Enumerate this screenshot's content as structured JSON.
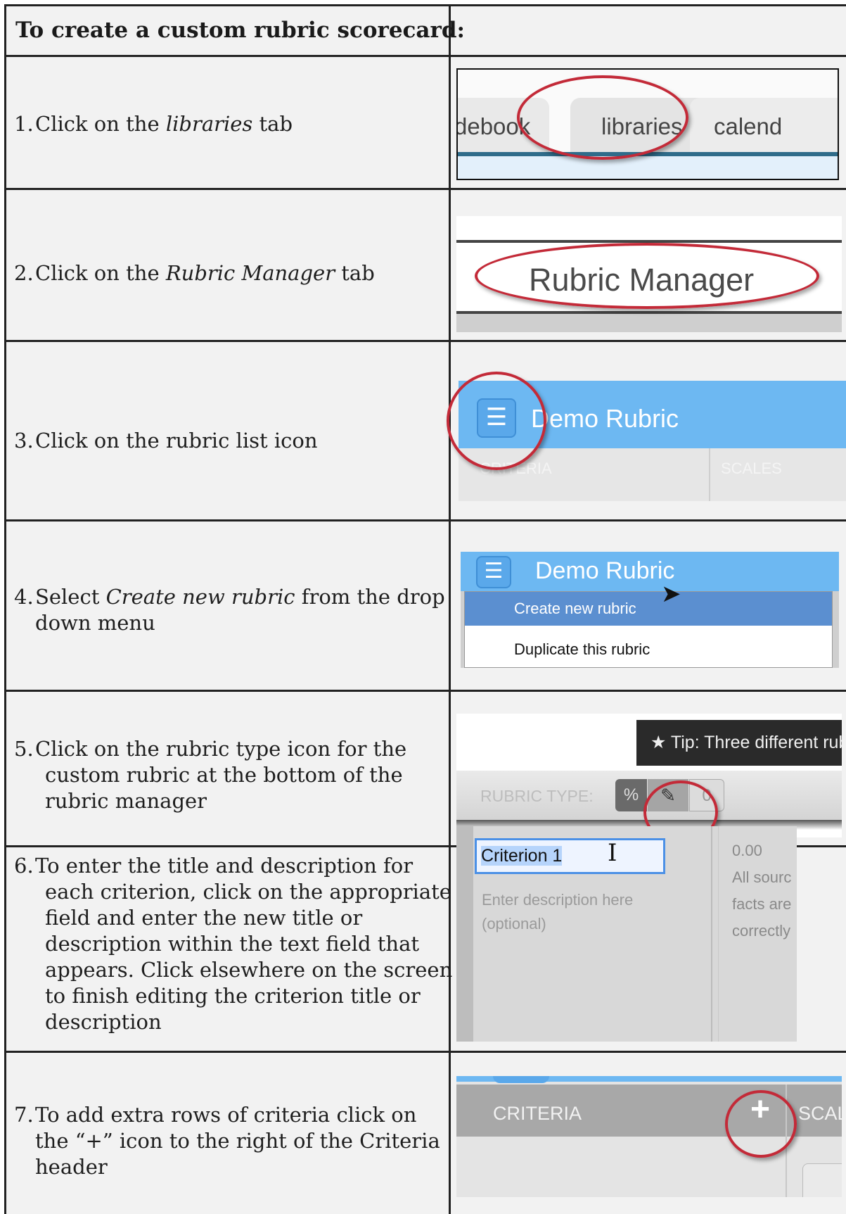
{
  "header": {
    "title": "To create a custom rubric scorecard:"
  },
  "steps": [
    {
      "num": "1.",
      "pre": "Click on the ",
      "em": "libraries",
      "post": " tab"
    },
    {
      "num": "2.",
      "pre": "Click on the ",
      "em": "Rubric Manager",
      "post": " tab"
    },
    {
      "num": "3.",
      "line1": "Click on the rubric list icon"
    },
    {
      "num": "4.",
      "pre": "Select ",
      "em": "Create new rubric",
      "post": " from the drop",
      "line2": "down menu"
    },
    {
      "num": "5.",
      "line1": "Click on the rubric type icon for the",
      "line2": "custom rubric at the bottom of the",
      "line3": "rubric manager"
    },
    {
      "num": "6.",
      "line1": "To enter the title and description for",
      "line2": "each criterion, click on the appropriate",
      "line3": "field and enter the new title or",
      "line4": "description within the text field that",
      "line5": "appears. Click elsewhere on the screen",
      "line6": "to finish editing the criterion title or",
      "line7": "description"
    },
    {
      "num": "7.",
      "line1": "To add extra rows of criteria click on",
      "line2": "the “+” icon to the right of the Criteria",
      "line3": "header"
    }
  ],
  "shot1": {
    "tab_left": "debook",
    "tab_mid": "libraries",
    "tab_right": "calend"
  },
  "shot2": {
    "label": "Rubric Manager"
  },
  "shot3": {
    "icon": "☰",
    "title": "Demo Rubric",
    "col1": "CRITERIA",
    "col2": "SCALES"
  },
  "shot4": {
    "icon": "☰",
    "title": "Demo Rubric",
    "item1": "Create new rubric",
    "item2": "Duplicate this rubric"
  },
  "shot5": {
    "tip": "★  Tip: Three different rubric",
    "rubric_type": "RUBRIC TYPE:",
    "btn_a": "%",
    "btn_b": "✎",
    "btn_c": "0"
  },
  "shot6": {
    "field_value": "Criterion 1",
    "desc1": "Enter description here",
    "desc2": "(optional)",
    "r1": "0.00",
    "r2": "All sourc",
    "r3": "facts are",
    "r4": "correctly"
  },
  "shot7": {
    "crit": "CRITERIA",
    "plus": "+",
    "sca": "SCAL"
  },
  "colors": {
    "ring": "#c32a38",
    "blue": "#6db8f2",
    "cell": "#f2f2f2"
  }
}
